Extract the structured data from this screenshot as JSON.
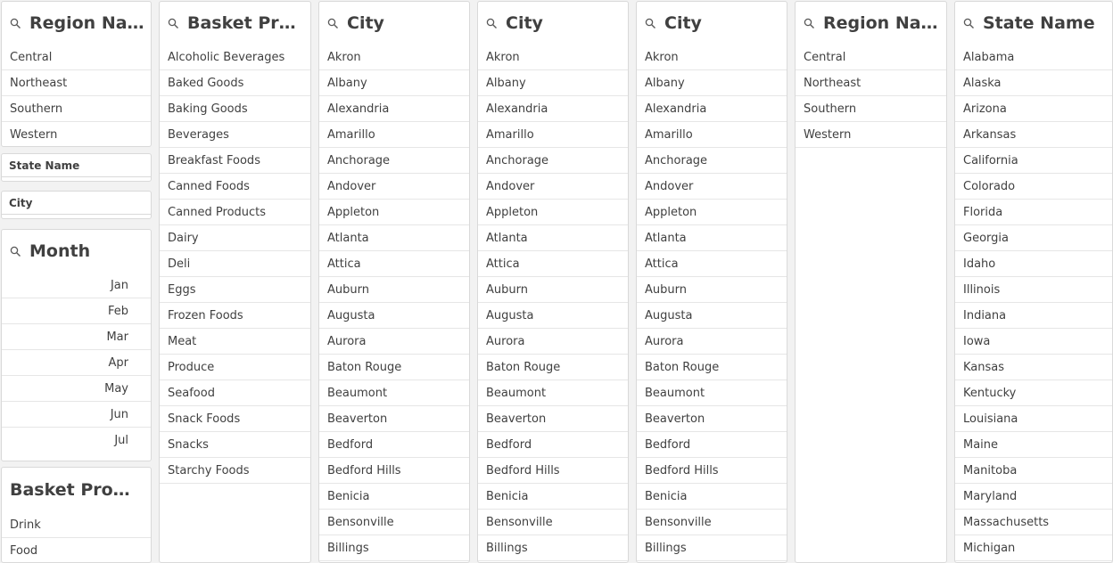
{
  "colors": {
    "panel_bg": "#ffffff",
    "background": "#f2f2f2",
    "border": "#d9d9d9",
    "text": "#404040",
    "row_divider": "#e6e6e6"
  },
  "icons": {
    "filter_search": "search-icon"
  },
  "left_column": {
    "region": {
      "title": "Region Name",
      "items": [
        "Central",
        "Northeast",
        "Southern",
        "Western"
      ]
    },
    "state_collapsed": {
      "title": "State Name"
    },
    "city_collapsed": {
      "title": "City"
    },
    "month": {
      "title": "Month",
      "items": [
        "Jan",
        "Feb",
        "Mar",
        "Apr",
        "May",
        "Jun",
        "Jul"
      ]
    },
    "basket_small": {
      "title": "Basket Pro…",
      "items": [
        "Drink",
        "Food"
      ]
    }
  },
  "basket_products": {
    "title": "Basket Prod…",
    "items": [
      "Alcoholic Beverages",
      "Baked Goods",
      "Baking Goods",
      "Beverages",
      "Breakfast Foods",
      "Canned Foods",
      "Canned Products",
      "Dairy",
      "Deli",
      "Eggs",
      "Frozen Foods",
      "Meat",
      "Produce",
      "Seafood",
      "Snack Foods",
      "Snacks",
      "Starchy Foods"
    ]
  },
  "city_panels": [
    {
      "title": "City",
      "items": [
        "Akron",
        "Albany",
        "Alexandria",
        "Amarillo",
        "Anchorage",
        "Andover",
        "Appleton",
        "Atlanta",
        "Attica",
        "Auburn",
        "Augusta",
        "Aurora",
        "Baton Rouge",
        "Beaumont",
        "Beaverton",
        "Bedford",
        "Bedford Hills",
        "Benicia",
        "Bensonville",
        "Billings"
      ]
    },
    {
      "title": "City",
      "items": [
        "Akron",
        "Albany",
        "Alexandria",
        "Amarillo",
        "Anchorage",
        "Andover",
        "Appleton",
        "Atlanta",
        "Attica",
        "Auburn",
        "Augusta",
        "Aurora",
        "Baton Rouge",
        "Beaumont",
        "Beaverton",
        "Bedford",
        "Bedford Hills",
        "Benicia",
        "Bensonville",
        "Billings"
      ]
    },
    {
      "title": "City",
      "items": [
        "Akron",
        "Albany",
        "Alexandria",
        "Amarillo",
        "Anchorage",
        "Andover",
        "Appleton",
        "Atlanta",
        "Attica",
        "Auburn",
        "Augusta",
        "Aurora",
        "Baton Rouge",
        "Beaumont",
        "Beaverton",
        "Bedford",
        "Bedford Hills",
        "Benicia",
        "Bensonville",
        "Billings"
      ]
    }
  ],
  "region_panel": {
    "title": "Region Name",
    "items": [
      "Central",
      "Northeast",
      "Southern",
      "Western"
    ]
  },
  "state_panel": {
    "title": "State Name",
    "items": [
      "Alabama",
      "Alaska",
      "Arizona",
      "Arkansas",
      "California",
      "Colorado",
      "Florida",
      "Georgia",
      "Idaho",
      "Illinois",
      "Indiana",
      "Iowa",
      "Kansas",
      "Kentucky",
      "Louisiana",
      "Maine",
      "Manitoba",
      "Maryland",
      "Massachusetts",
      "Michigan"
    ]
  }
}
